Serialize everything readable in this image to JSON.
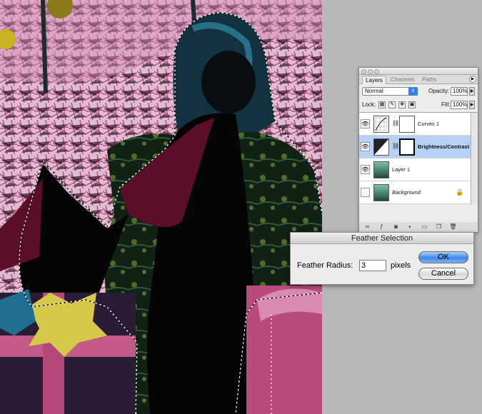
{
  "canvas": {
    "image": "inverted-color photo of a person holding a present in front of a tree"
  },
  "layers_panel": {
    "tabs": [
      {
        "label": "Layers",
        "active": true
      },
      {
        "label": "Channels",
        "active": false
      },
      {
        "label": "Paths",
        "active": false
      }
    ],
    "blend_mode": "Normal",
    "opacity_label": "Opacity:",
    "opacity_value": "100%",
    "lock_label": "Lock:",
    "fill_label": "Fill:",
    "fill_value": "100%",
    "layers": [
      {
        "name": "Curves 1",
        "type": "adjustment",
        "visible": true,
        "selected": false
      },
      {
        "name": "Brightness/Contrast ...",
        "type": "adjustment",
        "visible": true,
        "selected": true
      },
      {
        "name": "Layer 1",
        "type": "pixel",
        "visible": true,
        "selected": false
      },
      {
        "name": "Background",
        "type": "pixel",
        "visible": false,
        "selected": false,
        "locked": true
      }
    ],
    "bottom_tools": [
      "link-icon",
      "layer-style-icon",
      "mask-icon",
      "adjustment-icon",
      "folder-icon",
      "new-layer-icon",
      "trash-icon"
    ]
  },
  "feather_dialog": {
    "title": "Feather Selection",
    "radius_label": "Feather Radius:",
    "radius_value": "3",
    "unit": "pixels",
    "ok_label": "OK",
    "cancel_label": "Cancel"
  }
}
